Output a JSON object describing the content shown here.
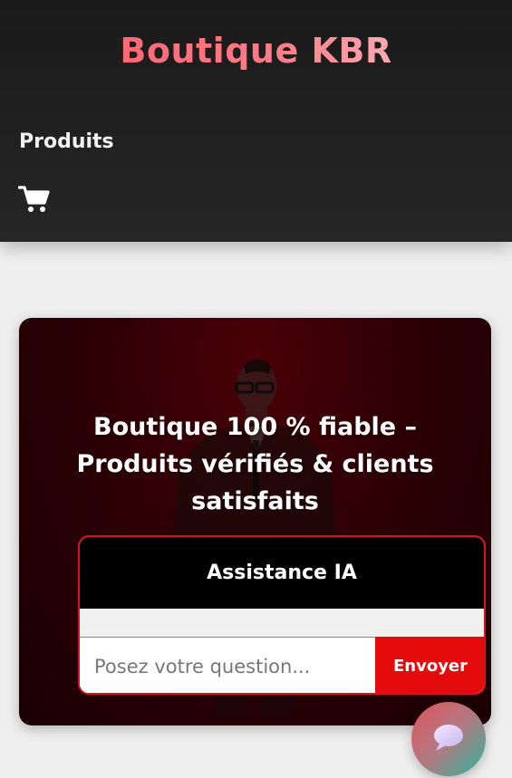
{
  "header": {
    "brand": "Boutique KBR",
    "nav": {
      "products": "Produits"
    },
    "cart_icon": "shopping-cart-icon"
  },
  "hero": {
    "title": "Boutique 100 % fiable – Produits vérifiés & clients satisfaits"
  },
  "assistant": {
    "title": "Assistance IA",
    "input_placeholder": "Posez votre question...",
    "input_value": "",
    "send_label": "Envoyer"
  },
  "chat_fab": {
    "icon": "chat-bubble-icon"
  },
  "colors": {
    "brand_accent": "#ff5a66",
    "send_button": "#e30b0b",
    "assistant_border": "#d6131e",
    "header_bg": "#1f1f1f",
    "hero_bg": "#2d0005"
  }
}
